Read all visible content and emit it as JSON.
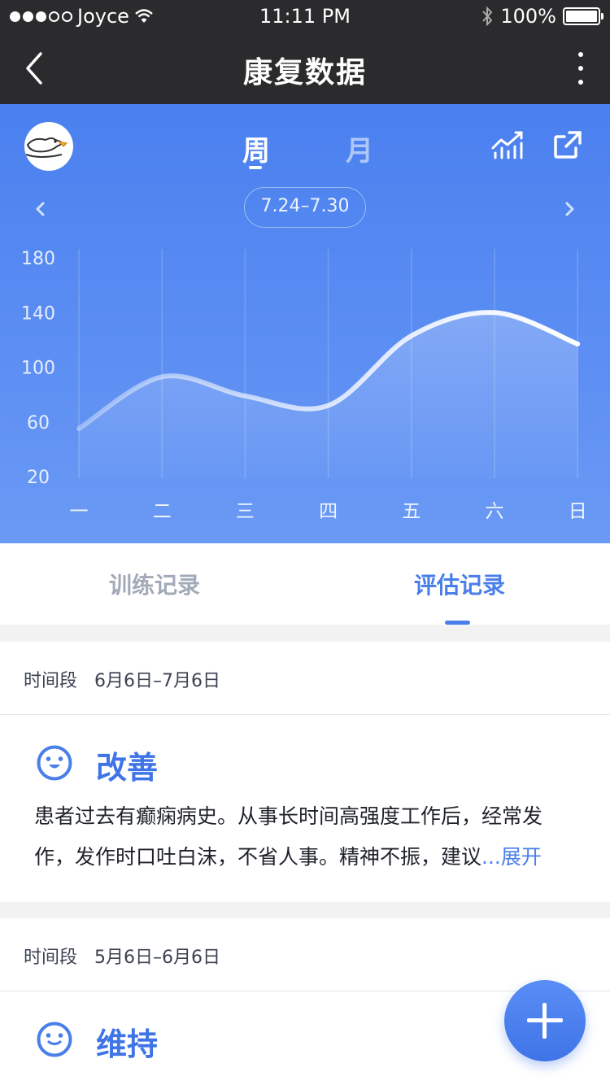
{
  "status_bar": {
    "carrier": "Joyce",
    "time": "11:11 PM",
    "battery": "100%"
  },
  "nav": {
    "title": "康复数据",
    "back_icon": "chevron-left-icon",
    "more_icon": "more-vertical-icon"
  },
  "header": {
    "period_tabs": [
      "周",
      "月"
    ],
    "active_period": "周",
    "date_range": "7.24–7.30",
    "icons": [
      "goose-avatar-icon",
      "trend-chart-icon",
      "share-icon",
      "chevron-left-icon",
      "chevron-right-icon"
    ]
  },
  "chart_data": {
    "type": "area",
    "categories": [
      "一",
      "二",
      "三",
      "四",
      "五",
      "六",
      "日"
    ],
    "values": [
      55,
      93,
      79,
      72,
      123,
      140,
      117
    ],
    "y_ticks": [
      20,
      60,
      100,
      140,
      180
    ],
    "ylim": [
      20,
      180
    ],
    "grid": "vertical",
    "colors": {
      "line": "#ffffff",
      "background": "#4a80ef"
    }
  },
  "tabs": {
    "items": [
      "训练记录",
      "评估记录"
    ],
    "active": "评估记录"
  },
  "records": [
    {
      "period_label": "时间段",
      "period_value": "6月6日–7月6日",
      "status": "改善",
      "text_line1": "患者过去有癫痫病史。从事长时间高强度工作后，经常发",
      "text_line2": "作，发作时口吐白沫，不省人事。精神不振，建议",
      "more_label": "...展开"
    },
    {
      "period_label": "时间段",
      "period_value": "5月6日–6月6日",
      "status": "维持"
    }
  ],
  "fab": {
    "icon": "plus-icon"
  },
  "colors": {
    "accent": "#4a7ee9",
    "navbar": "#2b2b2d"
  }
}
